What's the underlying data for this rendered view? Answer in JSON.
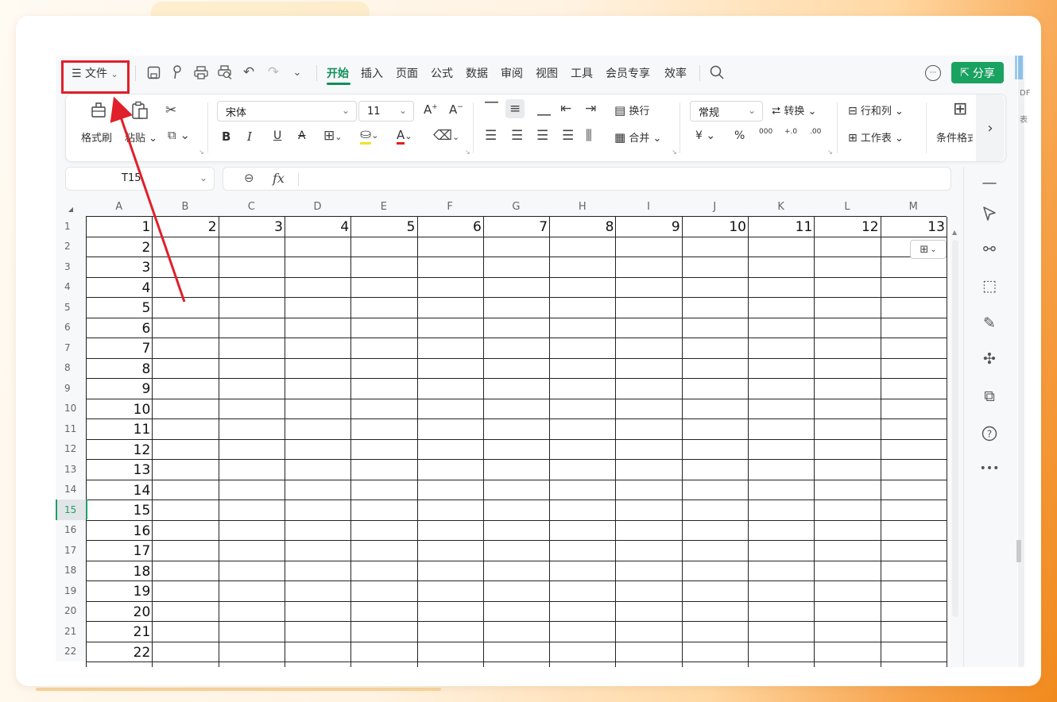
{
  "menu": {
    "file_icon": "☰",
    "file_label": "文件",
    "tabs": [
      "开始",
      "插入",
      "页面",
      "公式",
      "数据",
      "审阅",
      "视图",
      "工具",
      "会员专享",
      "效率"
    ],
    "active_tab": "开始",
    "share_label": "分享"
  },
  "ribbon": {
    "format_painter": "格式刷",
    "paste": "粘贴",
    "font_name": "宋体",
    "font_size": "11",
    "bold": "B",
    "italic": "I",
    "underline": "U",
    "strike": "A",
    "wrap": "换行",
    "merge": "合并",
    "number_format": "常规",
    "convert": "转换",
    "rows_cols": "行和列",
    "worksheet": "工作表",
    "cond_format": "条件格式",
    "currency": "¥",
    "percent": "%",
    "thousands": "000",
    "inc_dec": "+.0",
    "dec_dec": ".00"
  },
  "formula_bar": {
    "cell_ref": "T15",
    "fx": "fx",
    "content": ""
  },
  "grid": {
    "columns": [
      "A",
      "B",
      "C",
      "D",
      "E",
      "F",
      "G",
      "H",
      "I",
      "J",
      "K",
      "L",
      "M"
    ],
    "rows": [
      "1",
      "2",
      "3",
      "4",
      "5",
      "6",
      "7",
      "8",
      "9",
      "10",
      "11",
      "12",
      "13",
      "14",
      "15",
      "16",
      "17",
      "18",
      "19",
      "20",
      "21",
      "22"
    ],
    "selected_row": "15",
    "row1_values": [
      "1",
      "2",
      "3",
      "4",
      "5",
      "6",
      "7",
      "8",
      "9",
      "10",
      "11",
      "12",
      "13"
    ],
    "colA_values": [
      "1",
      "2",
      "3",
      "4",
      "5",
      "6",
      "7",
      "8",
      "9",
      "10",
      "11",
      "12",
      "13",
      "14",
      "15",
      "16",
      "17",
      "18",
      "19",
      "20",
      "21",
      "22"
    ]
  },
  "edge": {
    "line1": "DF",
    "line2": "表"
  },
  "colors": {
    "accent": "#1aa261",
    "annotation": "#e0202a",
    "active_tab": "#0f8f5a"
  },
  "annotation": {
    "target": "file-menu-button"
  }
}
